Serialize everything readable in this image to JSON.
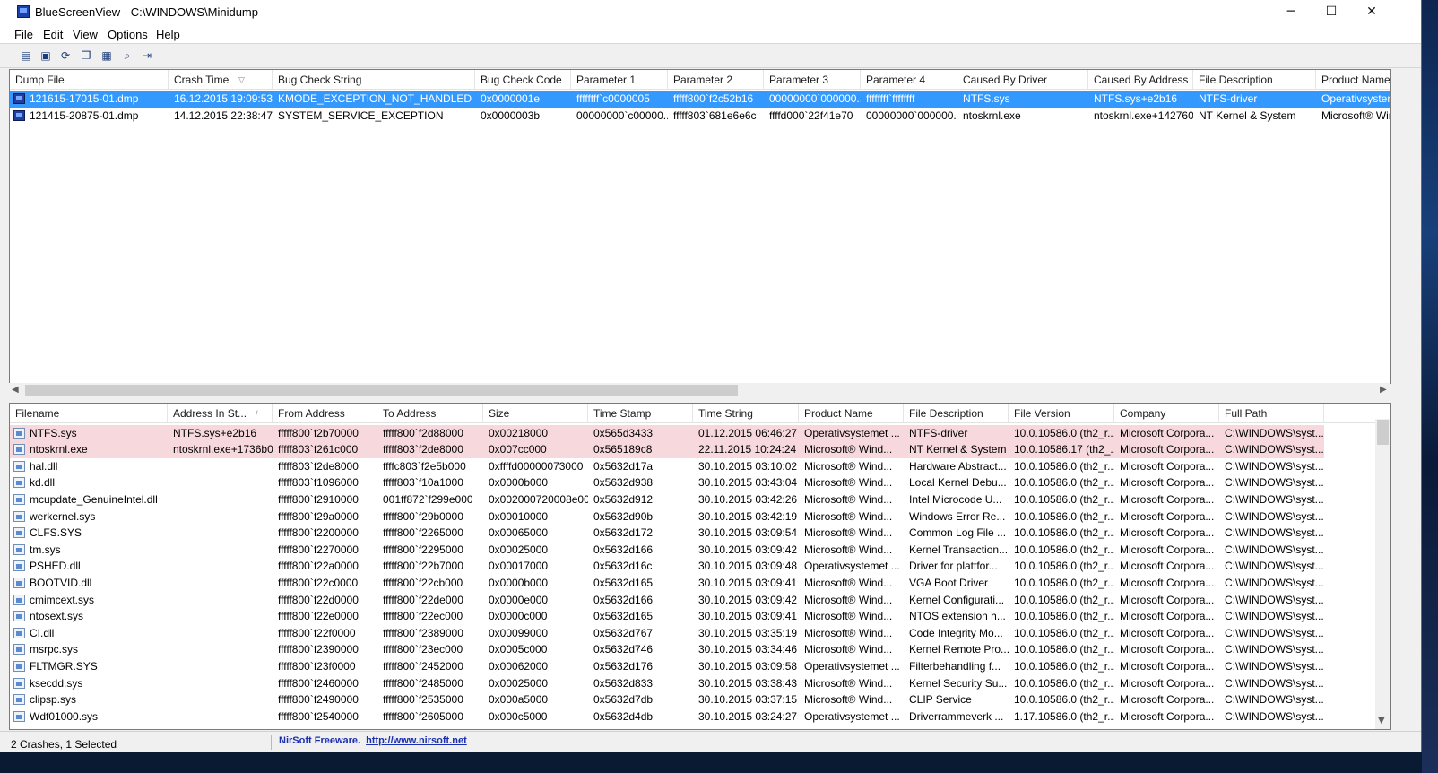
{
  "window": {
    "title": "BlueScreenView - C:\\WINDOWS\\Minidump",
    "minimize": "─",
    "maximize": "☐",
    "close": "✕"
  },
  "menu": [
    "File",
    "Edit",
    "View",
    "Options",
    "Help"
  ],
  "toolbar": [
    {
      "icon": "properties-icon",
      "glyph": "▤"
    },
    {
      "icon": "save-icon",
      "glyph": "▣"
    },
    {
      "icon": "refresh-icon",
      "glyph": "⟳"
    },
    {
      "icon": "copy-icon",
      "glyph": "❐"
    },
    {
      "icon": "html-report-icon",
      "glyph": "▦"
    },
    {
      "icon": "find-icon",
      "glyph": "⌕"
    },
    {
      "icon": "exit-icon",
      "glyph": "⇥"
    }
  ],
  "crash_table": {
    "columns": [
      "Dump File",
      "Crash Time",
      "Bug Check String",
      "Bug Check Code",
      "Parameter 1",
      "Parameter 2",
      "Parameter 3",
      "Parameter 4",
      "Caused By Driver",
      "Caused By Address",
      "File Description",
      "Product Name"
    ],
    "sort_indicator": "▽",
    "rows": [
      [
        "121615-17015-01.dmp",
        "16.12.2015 19:09:53",
        "KMODE_EXCEPTION_NOT_HANDLED",
        "0x0000001e",
        "ffffffff`c0000005",
        "fffff800`f2c52b16",
        "00000000`000000...",
        "ffffffff`ffffffff",
        "NTFS.sys",
        "NTFS.sys+e2b16",
        "NTFS-driver",
        "Operativsystemet"
      ],
      [
        "121415-20875-01.dmp",
        "14.12.2015 22:38:47",
        "SYSTEM_SERVICE_EXCEPTION",
        "0x0000003b",
        "00000000`c00000...",
        "fffff803`681e6e6c",
        "ffffd000`22f41e70",
        "00000000`000000...",
        "ntoskrnl.exe",
        "ntoskrnl.exe+142760",
        "NT Kernel & System",
        "Microsoft® Windows"
      ]
    ],
    "selected_index": 0
  },
  "module_table": {
    "columns": [
      "Filename",
      "Address In St...",
      "From Address",
      "To Address",
      "Size",
      "Time Stamp",
      "Time String",
      "Product Name",
      "File Description",
      "File Version",
      "Company",
      "Full Path"
    ],
    "sort_indicator": "/",
    "rows": [
      [
        "NTFS.sys",
        "NTFS.sys+e2b16",
        "fffff800`f2b70000",
        "fffff800`f2d88000",
        "0x00218000",
        "0x565d3433",
        "01.12.2015 06:46:27",
        "Operativsystemet ...",
        "NTFS-driver",
        "10.0.10586.0 (th2_r...",
        "Microsoft Corpora...",
        "C:\\WINDOWS\\syst..."
      ],
      [
        "ntoskrnl.exe",
        "ntoskrnl.exe+1736b0",
        "fffff803`f261c000",
        "fffff803`f2de8000",
        "0x007cc000",
        "0x565189c8",
        "22.11.2015 10:24:24",
        "Microsoft® Wind...",
        "NT Kernel & System",
        "10.0.10586.17 (th2_...",
        "Microsoft Corpora...",
        "C:\\WINDOWS\\syst..."
      ],
      [
        "hal.dll",
        "",
        "fffff803`f2de8000",
        "ffffc803`f2e5b000",
        "0xffffd00000073000",
        "0x5632d17a",
        "30.10.2015 03:10:02",
        "Microsoft® Wind...",
        "Hardware Abstract...",
        "10.0.10586.0 (th2_r...",
        "Microsoft Corpora...",
        "C:\\WINDOWS\\syst..."
      ],
      [
        "kd.dll",
        "",
        "fffff803`f1096000",
        "fffff803`f10a1000",
        "0x0000b000",
        "0x5632d938",
        "30.10.2015 03:43:04",
        "Microsoft® Wind...",
        "Local Kernel Debu...",
        "10.0.10586.0 (th2_r...",
        "Microsoft Corpora...",
        "C:\\WINDOWS\\syst..."
      ],
      [
        "mcupdate_GenuineIntel.dll",
        "",
        "fffff800`f2910000",
        "001ff872`f299e000",
        "0x002000720008e000",
        "0x5632d912",
        "30.10.2015 03:42:26",
        "Microsoft® Wind...",
        "Intel Microcode U...",
        "10.0.10586.0 (th2_r...",
        "Microsoft Corpora...",
        "C:\\WINDOWS\\syst..."
      ],
      [
        "werkernel.sys",
        "",
        "fffff800`f29a0000",
        "fffff800`f29b0000",
        "0x00010000",
        "0x5632d90b",
        "30.10.2015 03:42:19",
        "Microsoft® Wind...",
        "Windows Error Re...",
        "10.0.10586.0 (th2_r...",
        "Microsoft Corpora...",
        "C:\\WINDOWS\\syst..."
      ],
      [
        "CLFS.SYS",
        "",
        "fffff800`f2200000",
        "fffff800`f2265000",
        "0x00065000",
        "0x5632d172",
        "30.10.2015 03:09:54",
        "Microsoft® Wind...",
        "Common Log File ...",
        "10.0.10586.0 (th2_r...",
        "Microsoft Corpora...",
        "C:\\WINDOWS\\syst..."
      ],
      [
        "tm.sys",
        "",
        "fffff800`f2270000",
        "fffff800`f2295000",
        "0x00025000",
        "0x5632d166",
        "30.10.2015 03:09:42",
        "Microsoft® Wind...",
        "Kernel Transaction...",
        "10.0.10586.0 (th2_r...",
        "Microsoft Corpora...",
        "C:\\WINDOWS\\syst..."
      ],
      [
        "PSHED.dll",
        "",
        "fffff800`f22a0000",
        "fffff800`f22b7000",
        "0x00017000",
        "0x5632d16c",
        "30.10.2015 03:09:48",
        "Operativsystemet ...",
        "Driver for plattfor...",
        "10.0.10586.0 (th2_r...",
        "Microsoft Corpora...",
        "C:\\WINDOWS\\syst..."
      ],
      [
        "BOOTVID.dll",
        "",
        "fffff800`f22c0000",
        "fffff800`f22cb000",
        "0x0000b000",
        "0x5632d165",
        "30.10.2015 03:09:41",
        "Microsoft® Wind...",
        "VGA Boot Driver",
        "10.0.10586.0 (th2_r...",
        "Microsoft Corpora...",
        "C:\\WINDOWS\\syst..."
      ],
      [
        "cmimcext.sys",
        "",
        "fffff800`f22d0000",
        "fffff800`f22de000",
        "0x0000e000",
        "0x5632d166",
        "30.10.2015 03:09:42",
        "Microsoft® Wind...",
        "Kernel Configurati...",
        "10.0.10586.0 (th2_r...",
        "Microsoft Corpora...",
        "C:\\WINDOWS\\syst..."
      ],
      [
        "ntosext.sys",
        "",
        "fffff800`f22e0000",
        "fffff800`f22ec000",
        "0x0000c000",
        "0x5632d165",
        "30.10.2015 03:09:41",
        "Microsoft® Wind...",
        "NTOS extension h...",
        "10.0.10586.0 (th2_r...",
        "Microsoft Corpora...",
        "C:\\WINDOWS\\syst..."
      ],
      [
        "CI.dll",
        "",
        "fffff800`f22f0000",
        "fffff800`f2389000",
        "0x00099000",
        "0x5632d767",
        "30.10.2015 03:35:19",
        "Microsoft® Wind...",
        "Code Integrity Mo...",
        "10.0.10586.0 (th2_r...",
        "Microsoft Corpora...",
        "C:\\WINDOWS\\syst..."
      ],
      [
        "msrpc.sys",
        "",
        "fffff800`f2390000",
        "fffff800`f23ec000",
        "0x0005c000",
        "0x5632d746",
        "30.10.2015 03:34:46",
        "Microsoft® Wind...",
        "Kernel Remote Pro...",
        "10.0.10586.0 (th2_r...",
        "Microsoft Corpora...",
        "C:\\WINDOWS\\syst..."
      ],
      [
        "FLTMGR.SYS",
        "",
        "fffff800`f23f0000",
        "fffff800`f2452000",
        "0x00062000",
        "0x5632d176",
        "30.10.2015 03:09:58",
        "Operativsystemet ...",
        "Filterbehandling f...",
        "10.0.10586.0 (th2_r...",
        "Microsoft Corpora...",
        "C:\\WINDOWS\\syst..."
      ],
      [
        "ksecdd.sys",
        "",
        "fffff800`f2460000",
        "fffff800`f2485000",
        "0x00025000",
        "0x5632d833",
        "30.10.2015 03:38:43",
        "Microsoft® Wind...",
        "Kernel Security Su...",
        "10.0.10586.0 (th2_r...",
        "Microsoft Corpora...",
        "C:\\WINDOWS\\syst..."
      ],
      [
        "clipsp.sys",
        "",
        "fffff800`f2490000",
        "fffff800`f2535000",
        "0x000a5000",
        "0x5632d7db",
        "30.10.2015 03:37:15",
        "Microsoft® Wind...",
        "CLIP Service",
        "10.0.10586.0 (th2_r...",
        "Microsoft Corpora...",
        "C:\\WINDOWS\\syst..."
      ],
      [
        "Wdf01000.sys",
        "",
        "fffff800`f2540000",
        "fffff800`f2605000",
        "0x000c5000",
        "0x5632d4db",
        "30.10.2015 03:24:27",
        "Operativsystemet ...",
        "Driverrammeverk ...",
        "1.17.10586.0 (th2_r...",
        "Microsoft Corpora...",
        "C:\\WINDOWS\\syst..."
      ]
    ],
    "highlighted_count": 2
  },
  "status": {
    "left": "2 Crashes, 1 Selected",
    "vendor": "NirSoft Freeware.",
    "url": "http://www.nirsoft.net"
  },
  "colors": {
    "selection": "#3399ff",
    "highlight": "#f7d9dd",
    "link": "#1a2fb0"
  }
}
